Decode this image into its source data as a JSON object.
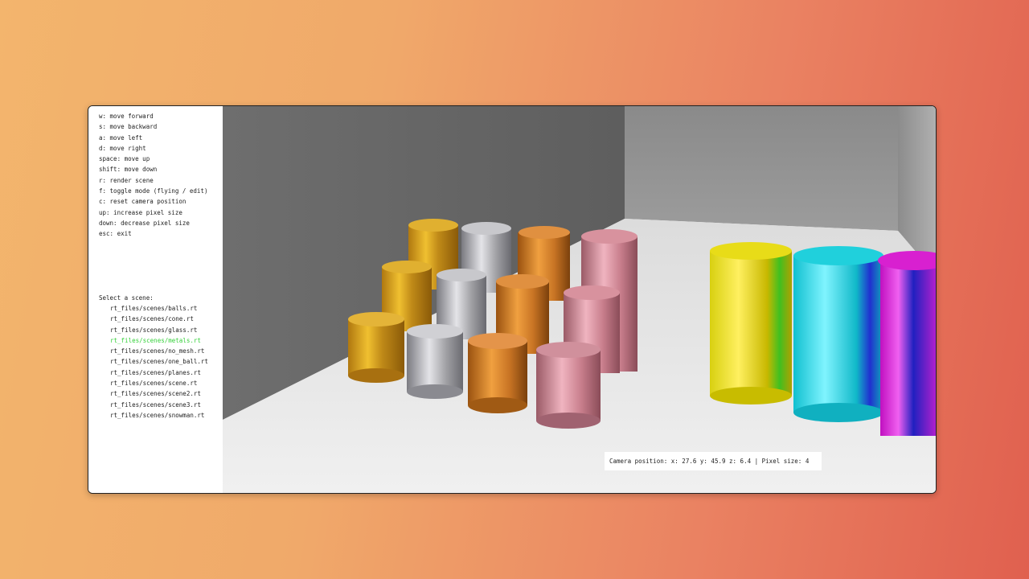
{
  "shortcuts": [
    "w: move forward",
    "s: move backward",
    "a: move left",
    "d: move right",
    "space: move up",
    "shift: move down",
    "r: render scene",
    "f: toggle mode (flying / edit)",
    "c: reset camera position",
    "up: increase pixel size",
    "down: decrease pixel size",
    "esc: exit"
  ],
  "scene_selector": {
    "title": "Select a scene:",
    "selected_index": 3,
    "selected_color": "#35d13a",
    "items": [
      "rt_files/scenes/balls.rt",
      "rt_files/scenes/cone.rt",
      "rt_files/scenes/glass.rt",
      "rt_files/scenes/metals.rt",
      "rt_files/scenes/no_mesh.rt",
      "rt_files/scenes/one_ball.rt",
      "rt_files/scenes/planes.rt",
      "rt_files/scenes/scene.rt",
      "rt_files/scenes/scene2.rt",
      "rt_files/scenes/scene3.rt",
      "rt_files/scenes/snowman.rt"
    ]
  },
  "status": {
    "text": "Camera position: x: 27.6 y: 45.9 z: 6.4 | Pixel size: 4"
  },
  "render_colors": {
    "gold": "#e0a820",
    "silver": "#b8b8bc",
    "copper": "#d8862c",
    "rose": "#d48a96",
    "yellow": "#f0e020",
    "cyan": "#20d8e0",
    "magenta": "#e020d8"
  }
}
